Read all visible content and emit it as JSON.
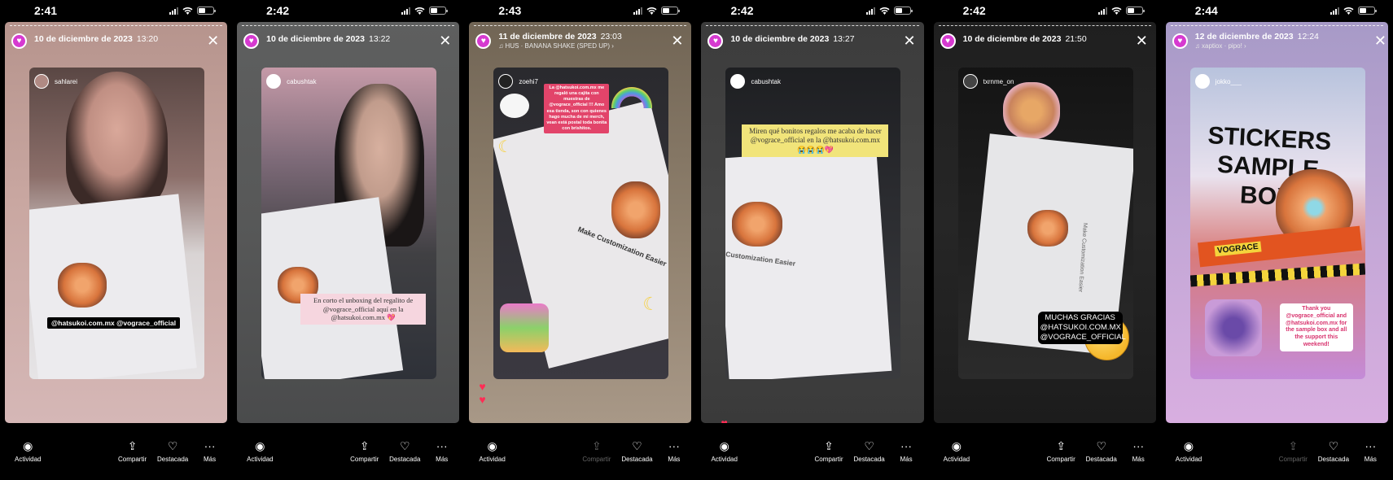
{
  "toolbar": {
    "activity": "Actividad",
    "share": "Compartir",
    "highlight": "Destacada",
    "more": "Más"
  },
  "phones": [
    {
      "status_time": "2:41",
      "date": "10 de diciembre de 2023",
      "time": "13:20",
      "music": "",
      "username": "sahlarei",
      "overlay": "@hatsukoi.com.mx @vograce_official",
      "hearts": 0
    },
    {
      "status_time": "2:42",
      "date": "10 de diciembre de 2023",
      "time": "13:22",
      "music": "",
      "username": "cabushtak",
      "overlay": "En corto el unboxing del regalito de @vograce_official aquí en la @hatsukoi.com.mx 💖",
      "hearts": 0
    },
    {
      "status_time": "2:43",
      "date": "11 de diciembre de 2023",
      "time": "23:03",
      "music": "HUS · BANANA SHAKE (SPED UP) ›",
      "username": "zoehi7",
      "overlay": "La @hatsukoi.com.mx me regaló una cajita con muestras de @vograce_official !!! Amo esa tienda, son con quienes hago mucha de mi merch, vean está postal toda bonita con brishitos.",
      "card_text": "Make Customization Easier",
      "hearts": 2
    },
    {
      "status_time": "2:42",
      "date": "10 de diciembre de 2023",
      "time": "13:27",
      "music": "",
      "username": "cabushtak",
      "overlay": "Miren qué bonitos regalos me acaba de hacer @vograce_official en la @hatsukoi.com.mx 😭😭😭💖",
      "card_text": "Customization Easier",
      "hearts": 1
    },
    {
      "status_time": "2:42",
      "date": "10 de diciembre de 2023",
      "time": "21:50",
      "music": "",
      "username": "txrnme_on",
      "overlay": "MUCHAS GRACIAS @HATSUKOI.COM.MX @VOGRACE_OFFICIAL",
      "card_text": "Make Customization Easier",
      "hearts": 0
    },
    {
      "status_time": "2:44",
      "date": "12 de diciembre de 2023",
      "time": "12:24",
      "music": "xaptiox · pipo! ›",
      "username": "jokko___",
      "headline": "STICKERS SAMPLE BOX",
      "brand": "VOGRACE",
      "overlay": "Thank you @vograce_official and @hatsukoi.com.mx for the sample box and all the support this weekend!",
      "hearts": 0,
      "share_dim": true
    }
  ]
}
